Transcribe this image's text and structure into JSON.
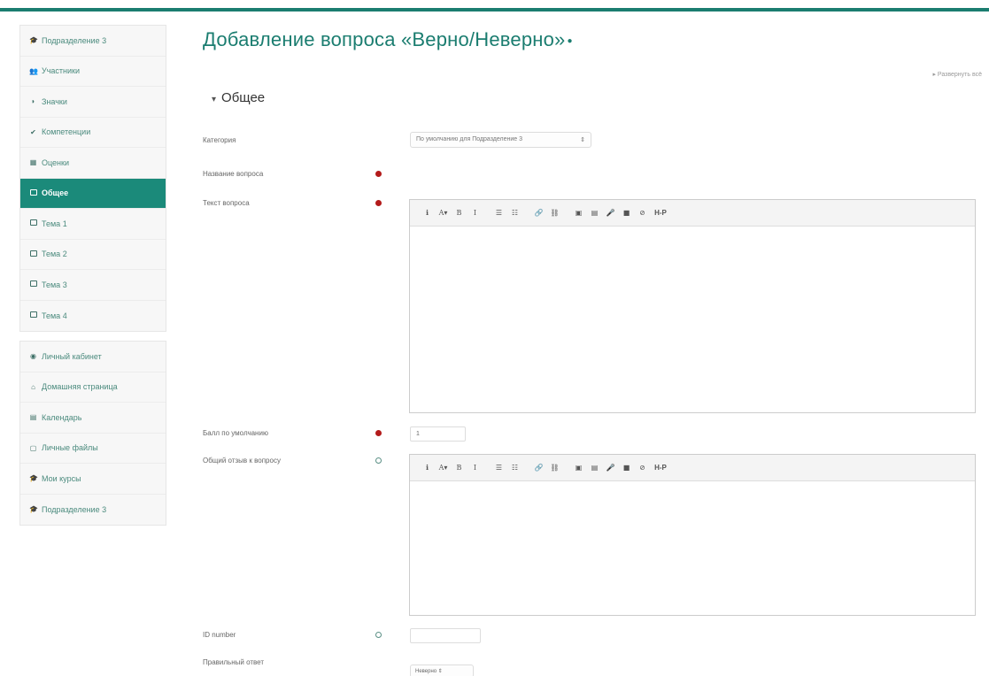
{
  "sidebar": {
    "course_items": [
      {
        "label": "Подразделение 3",
        "icon": "graduation-cap-icon"
      },
      {
        "label": "Участники",
        "icon": "users-icon"
      },
      {
        "label": "Значки",
        "icon": "badge-icon"
      },
      {
        "label": "Компетенции",
        "icon": "checkmark-icon"
      },
      {
        "label": "Оценки",
        "icon": "table-icon"
      },
      {
        "label": "Общее",
        "icon": "folder-icon",
        "active": true
      },
      {
        "label": "Тема 1",
        "icon": "folder-icon"
      },
      {
        "label": "Тема 2",
        "icon": "folder-icon"
      },
      {
        "label": "Тема 3",
        "icon": "folder-icon"
      },
      {
        "label": "Тема 4",
        "icon": "folder-icon"
      }
    ],
    "site_items": [
      {
        "label": "Личный кабинет",
        "icon": "dashboard-icon"
      },
      {
        "label": "Домашняя страница",
        "icon": "home-icon"
      },
      {
        "label": "Календарь",
        "icon": "calendar-icon"
      },
      {
        "label": "Личные файлы",
        "icon": "file-icon"
      },
      {
        "label": "Мои курсы",
        "icon": "graduation-cap-icon"
      },
      {
        "label": "Подразделение 3",
        "icon": "graduation-cap-icon"
      }
    ]
  },
  "main": {
    "title": "Добавление вопроса «Верно/Неверно»",
    "collapse_all": "▸ Развернуть всё",
    "section_title": "Общее",
    "fields": {
      "category_label": "Категория",
      "category_value": "По умолчанию для Подразделение 3",
      "question_name_label": "Название вопроса",
      "question_text_label": "Текст вопроса",
      "default_mark_label": "Балл по умолчанию",
      "default_mark_value": "1",
      "general_feedback_label": "Общий отзыв к вопросу",
      "id_number_label": "ID number",
      "correct_answer_label": "Правильный ответ",
      "correct_answer_value": "Неверно"
    },
    "toolbar_buttons": [
      "ℹ",
      "A▾",
      "B",
      "I",
      "☰",
      "☷",
      "🔗",
      "⛓",
      "▣",
      "▤",
      "🎤",
      "■",
      "⊘",
      "H-P"
    ]
  },
  "colors": {
    "accent": "#1b7d70",
    "active_nav": "#1b8a7a",
    "required": "#b31b1b"
  }
}
